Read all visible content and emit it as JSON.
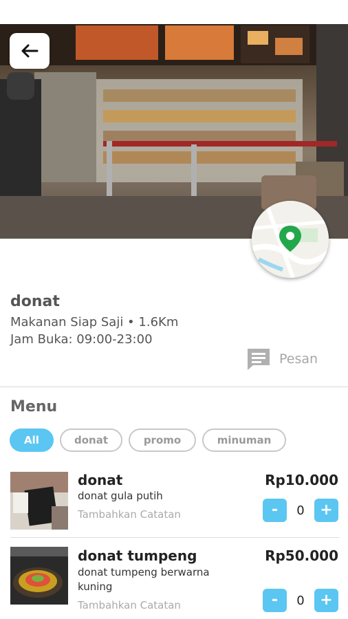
{
  "store": {
    "name": "donat",
    "category_distance": "Makanan Siap Saji • 1.6Km",
    "hours": "Jam Buka: 09:00-23:00"
  },
  "actions": {
    "message_label": "Pesan"
  },
  "menu": {
    "title": "Menu",
    "filters": [
      "All",
      "donat",
      "promo",
      "minuman"
    ],
    "active_filter": "All",
    "items": [
      {
        "name": "donat",
        "description": "donat gula putih",
        "note_placeholder": "Tambahkan Catatan",
        "price": "Rp10.000",
        "quantity": "0"
      },
      {
        "name": "donat tumpeng",
        "description": "donat tumpeng berwarna kuning",
        "note_placeholder": "Tambahkan Catatan",
        "price": "Rp50.000",
        "quantity": "0"
      }
    ],
    "stepper": {
      "minus": "-",
      "plus": "+"
    }
  },
  "icons": {
    "back": "arrow-left-icon",
    "map": "map-pin-icon",
    "message": "chat-bubble-icon"
  },
  "colors": {
    "accent": "#5bc6f2",
    "map_pin": "#22a84a"
  }
}
